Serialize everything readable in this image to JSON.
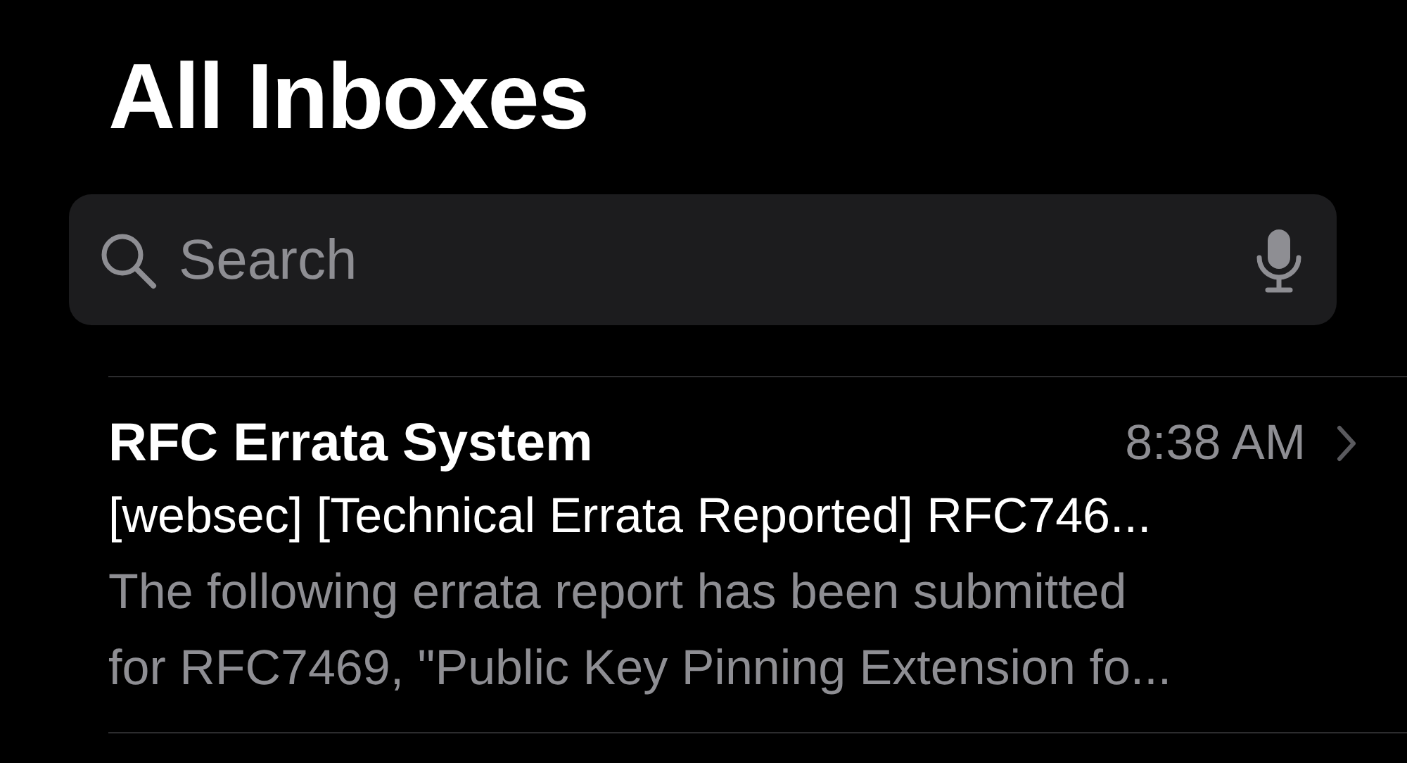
{
  "title": "All Inboxes",
  "search": {
    "placeholder": "Search"
  },
  "messages": [
    {
      "sender": "RFC Errata System",
      "time": "8:38 AM",
      "subject": "[websec] [Technical Errata Reported] RFC746...",
      "preview_lines": [
        "The following errata report has been submitted",
        "for RFC7469, \"Public Key Pinning Extension fo..."
      ]
    }
  ]
}
